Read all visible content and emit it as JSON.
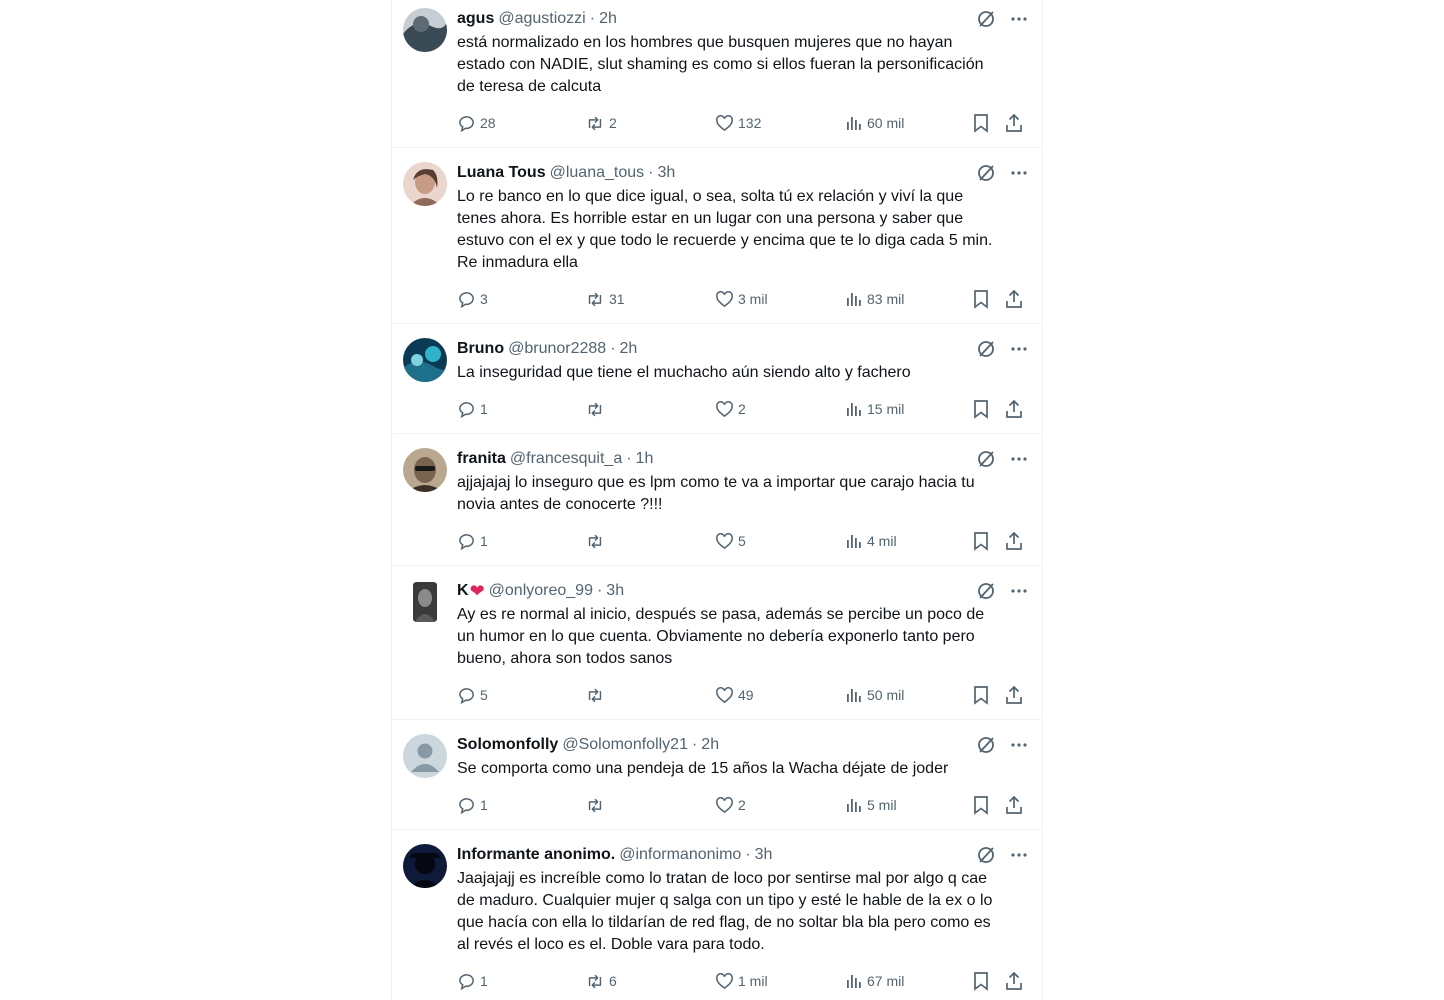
{
  "tweets": [
    {
      "name": "agus",
      "handle": "@agustiozzi",
      "time": "2h",
      "text": "está normalizado en los hombres que busquen mujeres que no hayan\nestado con NADIE, slut shaming es como si ellos fueran la personificación\nde teresa de calcuta",
      "replies": "28",
      "reposts": "2",
      "likes": "132",
      "views": "60 mil",
      "avatar_color": "#3a4a55"
    },
    {
      "name": "Luana Tous",
      "handle": "@luana_tous",
      "time": "3h",
      "text": "Lo re banco en lo que dice igual, o sea, solta tú ex relación y viví la que\ntenes ahora. Es horrible estar en un lugar con una persona y saber que\nestuvo con el ex y que todo le recuerde y encima que te lo diga cada 5 min.\nRe inmadura ella",
      "replies": "3",
      "reposts": "31",
      "likes": "3 mil",
      "views": "83 mil",
      "avatar_color": "#d9b8a8"
    },
    {
      "name": "Bruno",
      "handle": "@brunor2288",
      "time": "2h",
      "text": "La inseguridad que tiene el muchacho aún siendo alto y fachero",
      "replies": "1",
      "reposts": "",
      "likes": "2",
      "views": "15 mil",
      "avatar_color": "#1e6f8a"
    },
    {
      "name": "franita",
      "handle": "@francesquit_a",
      "time": "1h",
      "text": "ajjajajaj lo inseguro que es lpm como te va a importar que carajo hacia tu\nnovia antes de conocerte ?!!!",
      "replies": "1",
      "reposts": "",
      "likes": "5",
      "views": "4 mil",
      "avatar_color": "#6b5a48"
    },
    {
      "name": "K",
      "name_badge": "❤",
      "handle": "@onlyoreo_99",
      "time": "3h",
      "text": "Ay es re normal al inicio, después se pasa, además se percibe un poco de\nun humor en lo que cuenta. Obviamente no debería exponerlo tanto pero\nbueno, ahora son todos sanos",
      "replies": "5",
      "reposts": "",
      "likes": "49",
      "views": "50 mil",
      "avatar_color": "#555555"
    },
    {
      "name": "Solomonfolly",
      "handle": "@Solomonfolly21",
      "time": "2h",
      "text": "Se comporta como una pendeja de 15 años la Wacha déjate de joder",
      "replies": "1",
      "reposts": "",
      "likes": "2",
      "views": "5 mil",
      "avatar_color": "#ccd6dd"
    },
    {
      "name": "Informante anonimo.",
      "handle": "@informanonimo",
      "time": "3h",
      "text": "Jaajajajj es increíble como lo tratan de loco por sentirse mal por algo q cae\nde maduro. Cualquier mujer q salga con un tipo y esté le hable de la ex o lo\nque hacía con ella lo tildarían de red flag, de no soltar bla bla pero como es\nal revés el loco es el. Doble vara para todo.",
      "replies": "1",
      "reposts": "6",
      "likes": "1 mil",
      "views": "67 mil",
      "avatar_color": "#0f1a3a"
    }
  ],
  "colors": {
    "secondary_text": "#536471",
    "primary_text": "#0f1419",
    "divider": "#eff3f4",
    "badge_heart": "#e0245e"
  },
  "icons": [
    "reply-icon",
    "repost-icon",
    "like-icon",
    "views-icon",
    "bookmark-icon",
    "share-icon",
    "grok-icon",
    "more-icon"
  ]
}
